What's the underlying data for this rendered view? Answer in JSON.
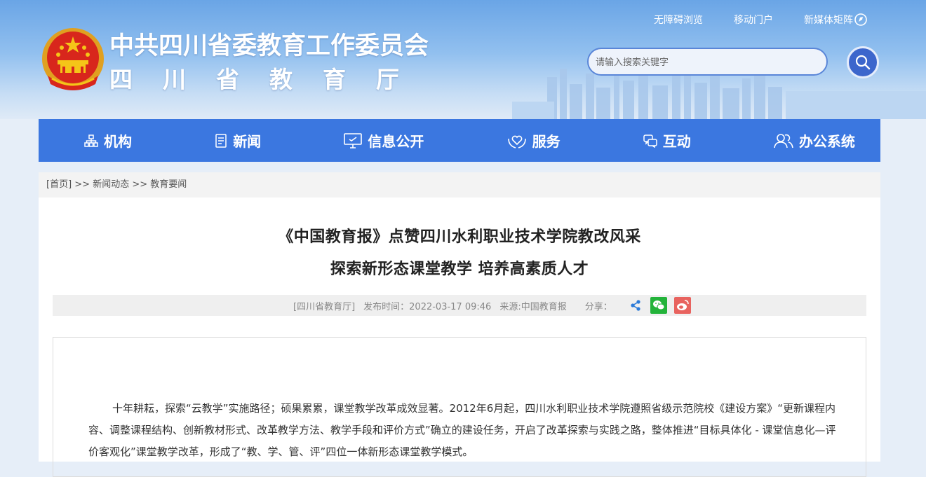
{
  "header": {
    "site_title": "中共四川省委教育工作委员会",
    "site_subtitle": "四川省教育厅",
    "top_links": [
      "无障碍浏览",
      "移动门户",
      "新媒体矩阵"
    ],
    "search": {
      "placeholder": "请输入搜索关键字"
    }
  },
  "nav": {
    "items": [
      {
        "label": "机构",
        "icon": "org-chart-icon"
      },
      {
        "label": "新闻",
        "icon": "document-icon"
      },
      {
        "label": "信息公开",
        "icon": "monitor-icon"
      },
      {
        "label": "服务",
        "icon": "heart-hands-icon"
      },
      {
        "label": "互动",
        "icon": "chat-icon"
      },
      {
        "label": "办公系统",
        "icon": "users-icon"
      }
    ]
  },
  "breadcrumb": {
    "items": [
      "[首页]",
      "新闻动态",
      "教育要闻"
    ],
    "separator": " >> "
  },
  "article": {
    "title_line1": "《中国教育报》点赞四川水利职业技术学院教改风采",
    "title_line2": "探索新形态课堂教学 培养高素质人才",
    "source_tag": "[四川省教育厅]",
    "publish_time": "发布时间：2022-03-17 09:46",
    "origin": "来源:中国教育报",
    "share_label": "分享：",
    "share_icons": [
      "share-icon",
      "wechat-icon",
      "weibo-icon"
    ],
    "paragraph": "十年耕耘，探索“云教学”实施路径；硕果累累，课堂教学改革成效显著。2012年6月起，四川水利职业技术学院遵照省级示范院校《建设方案》“更新课程内容、调整课程结构、创新教材形式、改革教学方法、教学手段和评价方式”确立的建设任务，开启了改革探索与实践之路，整体推进“目标具体化 - 课堂信息化—评价客观化”课堂教学改革，形成了“教、学、管、评”四位一体新形态课堂教学模式。"
  },
  "colors": {
    "nav_bg": "#3b77e0",
    "search_btn": "#3c66cc",
    "wechat": "#23b33a",
    "weibo": "#e8635f"
  }
}
